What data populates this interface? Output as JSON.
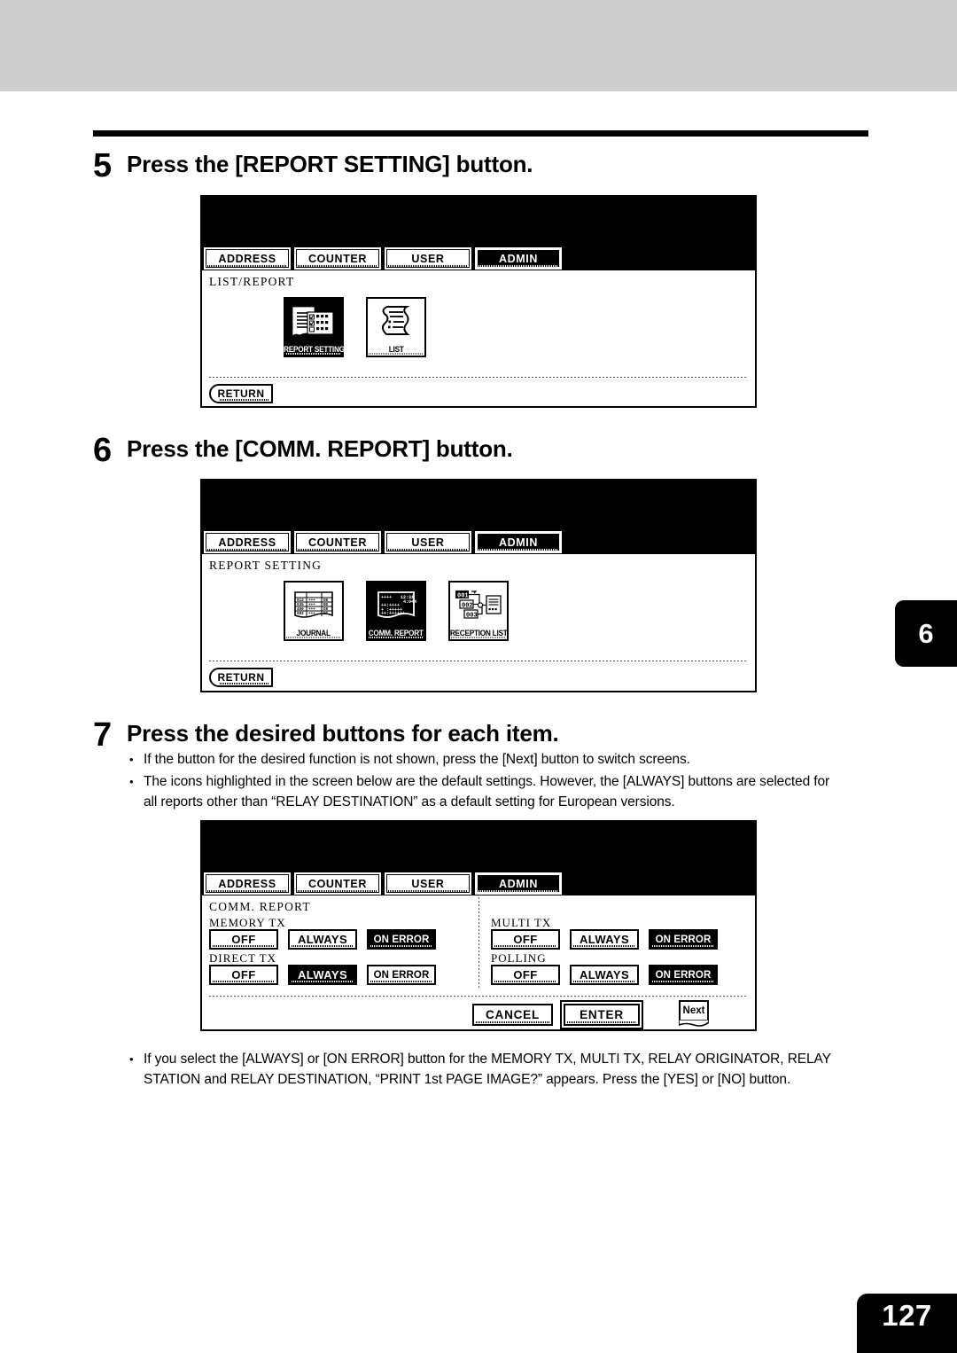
{
  "page": {
    "number": "127",
    "side_index": "6"
  },
  "steps": [
    {
      "number": "5",
      "heading": "Press the [REPORT SETTING] button."
    },
    {
      "number": "6",
      "heading": "Press the [COMM. REPORT] button."
    },
    {
      "number": "7",
      "heading": "Press the desired buttons for each item.",
      "bullets": [
        "If the button for the desired function is not shown, press the [Next] button to switch screens.",
        "The icons highlighted in the screen below are the default settings. However, the [ALWAYS] buttons are selected for all reports other than “RELAY DESTINATION” as a default setting for European versions."
      ]
    }
  ],
  "footnote": [
    "If you select the [ALWAYS] or [ON ERROR] button for the MEMORY TX, MULTI TX, RELAY ORIGINATOR, RELAY STATION and RELAY DESTINATION, “PRINT 1st PAGE IMAGE?” appears. Press the [YES] or [NO] button."
  ],
  "tabs": [
    {
      "label": "ADDRESS",
      "selected": false
    },
    {
      "label": "COUNTER",
      "selected": false
    },
    {
      "label": "USER",
      "selected": false
    },
    {
      "label": "ADMIN",
      "selected": true
    }
  ],
  "panels": [
    {
      "id": "list-report",
      "title": "LIST/REPORT",
      "icons": [
        {
          "label": "REPORT SETTING",
          "icon": "report-setting-icon",
          "selected": true
        },
        {
          "label": "LIST",
          "icon": "list-document-icon",
          "selected": false
        }
      ],
      "return_label": "RETURN"
    },
    {
      "id": "report-setting",
      "title": "REPORT SETTING",
      "icons": [
        {
          "label": "JOURNAL",
          "icon": "journal-table-icon",
          "selected": false
        },
        {
          "label": "COMM. REPORT",
          "icon": "comm-report-icon",
          "selected": true
        },
        {
          "label": "RECEPTION LIST",
          "icon": "reception-list-icon",
          "selected": false
        }
      ],
      "return_label": "RETURN"
    },
    {
      "id": "comm-report",
      "title": "COMM. REPORT",
      "groups": [
        {
          "label": "MEMORY TX",
          "options": [
            {
              "label": "OFF",
              "selected": false
            },
            {
              "label": "ALWAYS",
              "selected": false
            },
            {
              "label": "ON ERROR",
              "selected": true
            }
          ]
        },
        {
          "label": "MULTI TX",
          "options": [
            {
              "label": "OFF",
              "selected": false
            },
            {
              "label": "ALWAYS",
              "selected": false
            },
            {
              "label": "ON ERROR",
              "selected": true
            }
          ]
        },
        {
          "label": "DIRECT TX",
          "options": [
            {
              "label": "OFF",
              "selected": false
            },
            {
              "label": "ALWAYS",
              "selected": true
            },
            {
              "label": "ON ERROR",
              "selected": false
            }
          ]
        },
        {
          "label": "POLLING",
          "options": [
            {
              "label": "OFF",
              "selected": false
            },
            {
              "label": "ALWAYS",
              "selected": false
            },
            {
              "label": "ON ERROR",
              "selected": true
            }
          ]
        }
      ],
      "actions": {
        "cancel": "CANCEL",
        "enter": "ENTER",
        "next": "Next"
      }
    }
  ],
  "colors": {
    "top_band": "#cdcdcd",
    "ink": "#000000",
    "paper": "#ffffff"
  }
}
